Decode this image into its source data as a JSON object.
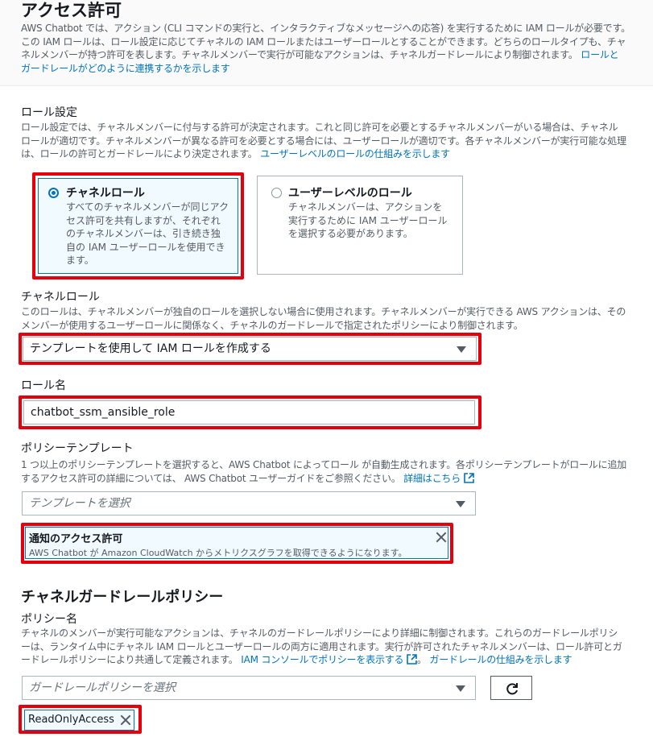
{
  "access": {
    "title": "アクセス許可",
    "desc_line1": "AWS Chatbot では、アクション (CLI コマンドの実行と、インタラクティブなメッセージへの応答) を実行するために IAM ロールが必要です。",
    "desc_line2": "この IAM ロールは、ロール設定に応じてチャネルの IAM ロールまたはユーザーロールとすることができます。どちらのロールタイプも、チャ",
    "desc_line3a": "ネルメンバーが持つ許可を表します。チャネルメンバーで実行が可能なアクションは、チャネルガードレールにより制御されます。",
    "desc_link_a": "ロールと",
    "desc_link_b": "ガードレールがどのように連携するかを示します"
  },
  "role_settings": {
    "label": "ロール設定",
    "desc_line1": "ロール設定では、チャネルメンバーに付与する許可が決定されます。これと同じ許可を必要とするチャネルメンバーがいる場合は、チャネル",
    "desc_line2": "ロールが適切です。チャネルメンバーが異なる許可を必要とする場合には、ユーザーロールが適切です。各チャネルメンバーが実行可能な処理",
    "desc_line3": "は、ロールの許可とガードレールにより決定されます。",
    "desc_link": "ユーザーレベルのロールの仕組みを示します",
    "options": [
      {
        "title": "チャネルロール",
        "desc": [
          "すべてのチャネルメンバーが同じアク",
          "セス許可を共有しますが、それぞれ",
          "のチャネルメンバーは、引き続き独",
          "自の IAM ユーザーロールを使用でき",
          "ます。"
        ],
        "selected": true
      },
      {
        "title": "ユーザーレベルのロール",
        "desc": [
          "チャネルメンバーは、アクションを",
          "実行するために IAM ユーザーロール",
          "を選択する必要があります。"
        ],
        "selected": false
      }
    ]
  },
  "channel_role": {
    "label": "チャネルロール",
    "desc_line1": "このロールは、チャネルメンバーが独自のロールを選択しない場合に使用されます。チャネルメンバーが実行できる AWS アクションは、その",
    "desc_line2": "メンバーが使用するユーザーロールに関係なく、チャネルのガードレールで指定されたポリシーにより制御されます。",
    "selected_value": "テンプレートを使用して IAM ロールを作成する"
  },
  "role_name": {
    "label": "ロール名",
    "value": "chatbot_ssm_ansible_role"
  },
  "policy_templates": {
    "label": "ポリシーテンプレート",
    "desc_line1": "1 つ以上のポリシーテンプレートを選択すると、AWS Chatbot によってロール が自動生成されます。各ポリシーテンプレートがロールに追加",
    "desc_line2": "するアクセス許可の詳細については、 AWS Chatbot ユーザーガイドをご参照ください。",
    "desc_link": "詳細はこちら",
    "placeholder": "テンプレートを選択",
    "token_title": "通知のアクセス許可",
    "token_desc": "AWS Chatbot が Amazon CloudWatch からメトリクスグラフを取得できるようになります。"
  },
  "guardrail": {
    "heading": "チャネルガードレールポリシー",
    "label": "ポリシー名",
    "desc_line1": "チャネルのメンバーが実行可能なアクションは、チャネルのガードレールポリシーにより詳細に制御されます。これらのガードレールポリシ",
    "desc_line2": "ーは、ランタイム中にチャネル IAM ロールとユーザーロールの両方に適用されます。実行が許可されたチャネルメンバーは、ロール許可とガ",
    "desc_line3": "ードレールポリシーにより共通して定義されます。",
    "desc_link1": "IAM コンソールでポリシーを表示する",
    "desc_sep": "。",
    "desc_link2": "ガードレールの仕組みを示します",
    "placeholder": "ガードレールポリシーを選択",
    "token": "ReadOnlyAccess"
  },
  "colors": {
    "link": "#0073bb",
    "highlight": "#e5000b",
    "selected_bg": "#f1faff"
  },
  "icons": {
    "radio": "radio-button",
    "caret": "caret-down-icon",
    "close": "close-icon",
    "external": "external-link-icon",
    "refresh": "refresh-icon"
  }
}
